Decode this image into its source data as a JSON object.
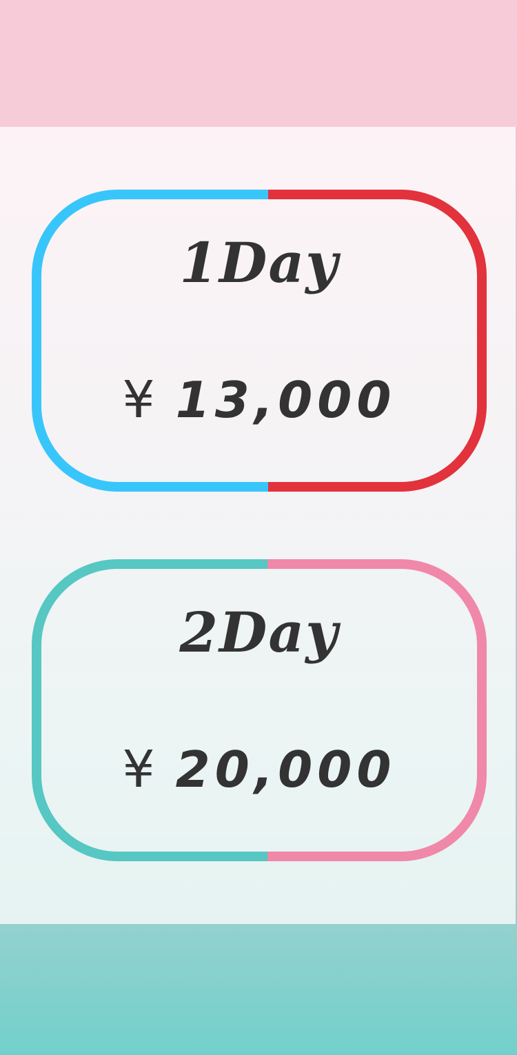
{
  "plans": [
    {
      "title": "1Day",
      "currency": "¥",
      "price": "13,000",
      "border_left_color": "#38c6fa",
      "border_right_color": "#e2323c"
    },
    {
      "title": "2Day",
      "currency": "¥",
      "price": "20,000",
      "border_left_color": "#56c7c3",
      "border_right_color": "#f088a9"
    }
  ],
  "colors": {
    "top_band": "#f8cbd9",
    "bottom_band": "#78d0cc",
    "text": "#333333"
  }
}
